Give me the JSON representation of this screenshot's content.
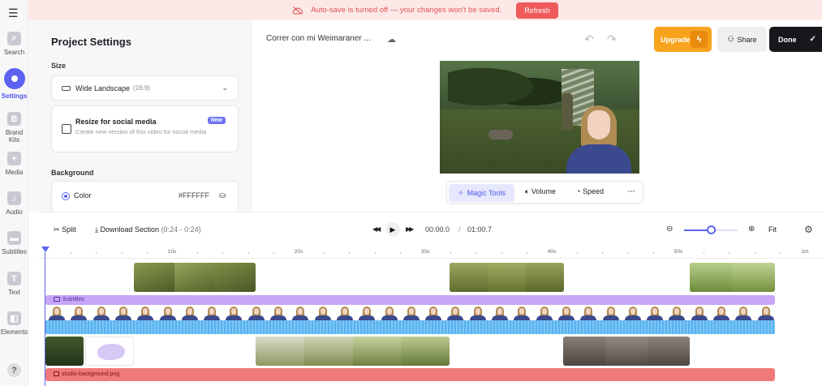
{
  "banner": {
    "message": "Auto-save is turned off — your changes won't be saved.",
    "refresh_label": "Refresh",
    "color": "#e15454"
  },
  "rail": {
    "menu_icon": "hamburger-icon",
    "items": [
      {
        "label": "Search",
        "icon": "search-icon"
      },
      {
        "label": "Settings",
        "icon": "settings-icon",
        "active": true
      },
      {
        "label": "Brand Kits",
        "icon": "brand-kit-icon"
      },
      {
        "label": "Media",
        "icon": "plus-icon"
      },
      {
        "label": "Audio",
        "icon": "music-icon"
      },
      {
        "label": "Subtitles",
        "icon": "subtitles-icon"
      },
      {
        "label": "Text",
        "icon": "text-icon"
      },
      {
        "label": "Elements",
        "icon": "elements-icon"
      }
    ],
    "help_icon": "help-icon"
  },
  "panel": {
    "title": "Project Settings",
    "size_label": "Size",
    "size_value": "Wide Landscape",
    "size_ratio": "(16:9)",
    "resize_title": "Resize for social media",
    "resize_desc": "Create new version of this video for social media",
    "resize_badge": "New",
    "background_label": "Background",
    "color_label": "Color",
    "color_value": "#FFFFFF"
  },
  "topbar": {
    "project_title": "Correr con mi Weimaraner ...",
    "upgrade_label": "Upgrade",
    "share_label": "Share",
    "done_label": "Done",
    "accent": "#5b63f0",
    "upgrade_color": "#f8a31d"
  },
  "preview_toolbar": {
    "magic_label": "Magic Tools",
    "volume_label": "Volume",
    "speed_label": "Speed",
    "more_label": "···"
  },
  "timeline": {
    "split_label": "Split",
    "download_label": "Download Section",
    "download_range": "(0:24 - 0:24)",
    "current_time": "00:00.0",
    "separator": "/",
    "total_time": "01:00.7",
    "fit_label": "Fit",
    "zoom_level": 0.5,
    "ruler_labels": [
      "10s",
      "20s",
      "30s",
      "40s",
      "50s",
      "1m"
    ],
    "subtitles_label": "Subtitles",
    "background_track_label": "studio-background.png"
  }
}
